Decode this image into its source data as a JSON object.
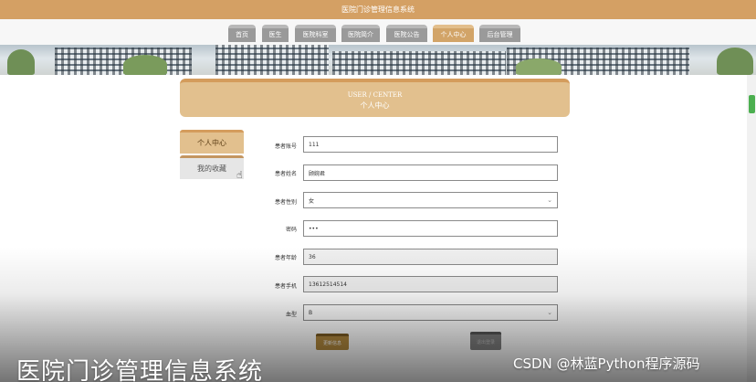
{
  "app": {
    "title": "医院门诊管理信息系统"
  },
  "nav": {
    "items": [
      {
        "label": "首页"
      },
      {
        "label": "医生"
      },
      {
        "label": "医院科室"
      },
      {
        "label": "医院简介"
      },
      {
        "label": "医院公告"
      },
      {
        "label": "个人中心",
        "active": true
      },
      {
        "label": "后台管理"
      }
    ]
  },
  "center": {
    "title_en": "USER / CENTER",
    "title_cn": "个人中心"
  },
  "sidebar": {
    "items": [
      {
        "label": "个人中心",
        "active": true
      },
      {
        "label": "我的收藏"
      }
    ]
  },
  "form": {
    "fields": [
      {
        "label": "患者账号",
        "value": "111",
        "type": "text"
      },
      {
        "label": "患者姓名",
        "value": "顾婉君",
        "type": "text"
      },
      {
        "label": "患者性别",
        "value": "女",
        "type": "select"
      },
      {
        "label": "密码",
        "value": "•••",
        "type": "password"
      },
      {
        "label": "患者年龄",
        "value": "36",
        "type": "readonly"
      },
      {
        "label": "患者手机",
        "value": "13612514514",
        "type": "readonly"
      },
      {
        "label": "血型",
        "value": "B",
        "type": "select"
      }
    ],
    "update_button": "更新信息",
    "logout_button": "退出登录"
  },
  "watermark": {
    "title": "医院门诊管理信息系统",
    "csdn": "CSDN @林蓝Python程序源码"
  },
  "colors": {
    "brand": "#d4a064",
    "header": "#e2c08e",
    "active_tab": "#d2a468"
  }
}
